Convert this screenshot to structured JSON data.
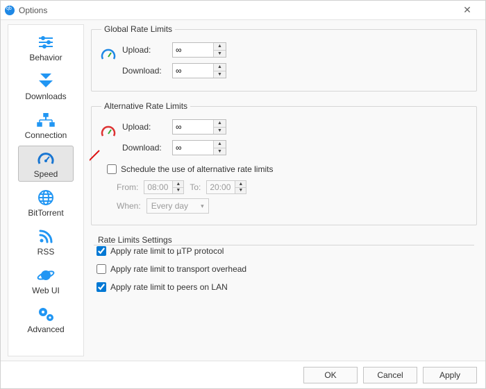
{
  "window": {
    "title": "Options"
  },
  "sidebar": {
    "items": [
      {
        "label": "Behavior"
      },
      {
        "label": "Downloads"
      },
      {
        "label": "Connection"
      },
      {
        "label": "Speed"
      },
      {
        "label": "BitTorrent"
      },
      {
        "label": "RSS"
      },
      {
        "label": "Web UI"
      },
      {
        "label": "Advanced"
      }
    ],
    "selected_index": 3
  },
  "global_limits": {
    "legend": "Global Rate Limits",
    "upload_label": "Upload:",
    "upload_value": "∞",
    "download_label": "Download:",
    "download_value": "∞"
  },
  "alt_limits": {
    "legend": "Alternative Rate Limits",
    "upload_label": "Upload:",
    "upload_value": "∞",
    "download_label": "Download:",
    "download_value": "∞",
    "schedule_label": "Schedule the use of alternative rate limits",
    "schedule_checked": false,
    "from_label": "From:",
    "from_value": "08:00",
    "to_label": "To:",
    "to_value": "20:00",
    "when_label": "When:",
    "when_value": "Every day"
  },
  "settings": {
    "legend": "Rate Limits Settings",
    "utp_label": "Apply rate limit to µTP protocol",
    "utp_checked": true,
    "overhead_label": "Apply rate limit to transport overhead",
    "overhead_checked": false,
    "lan_label": "Apply rate limit to peers on LAN",
    "lan_checked": true
  },
  "footer": {
    "ok": "OK",
    "cancel": "Cancel",
    "apply": "Apply"
  }
}
